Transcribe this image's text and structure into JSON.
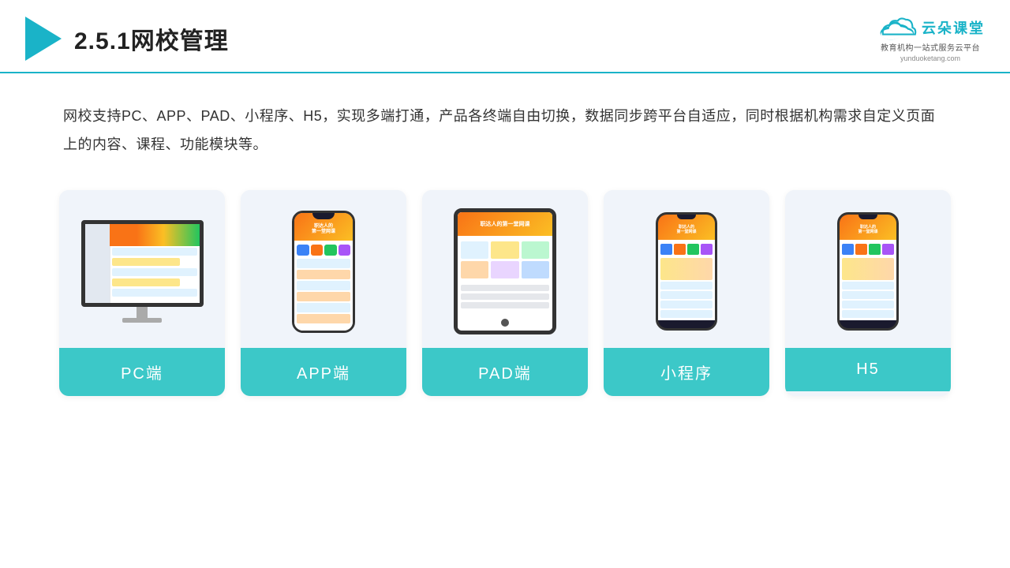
{
  "header": {
    "title": "2.5.1网校管理",
    "brand_name": "云朵课堂",
    "brand_tagline": "教育机构一站式服务云平台",
    "brand_url": "yunduoketang.com"
  },
  "description": {
    "text": "网校支持PC、APP、PAD、小程序、H5，实现多端打通，产品各终端自由切换，数据同步跨平台自适应，同时根据机构需求自定义页面上的内容、课程、功能模块等。"
  },
  "cards": [
    {
      "id": "pc",
      "label": "PC端"
    },
    {
      "id": "app",
      "label": "APP端"
    },
    {
      "id": "pad",
      "label": "PAD端"
    },
    {
      "id": "mini",
      "label": "小程序"
    },
    {
      "id": "h5",
      "label": "H5"
    }
  ]
}
